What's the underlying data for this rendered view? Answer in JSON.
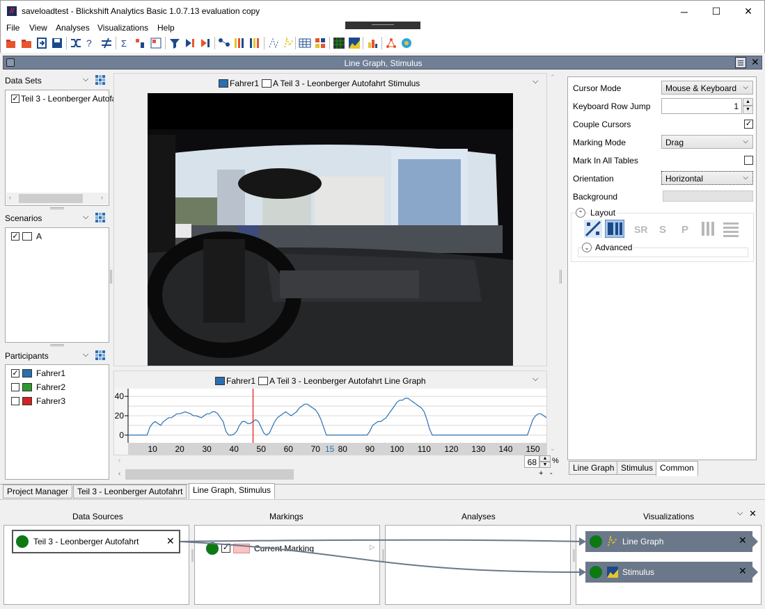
{
  "window": {
    "title": "saveloadtest - Blickshift Analytics Basic 1.0.7.13 evaluation copy",
    "logo_text": "//",
    "minimize": "─",
    "maximize": "☐",
    "close": "✕"
  },
  "menu": [
    "File",
    "View",
    "Analyses",
    "Visualizations",
    "Help"
  ],
  "panel_title": "Line Graph, Stimulus",
  "left": {
    "data_sets_title": "Data Sets",
    "data_set_item": "Teil 3 - Leonberger Autofa",
    "scenarios_title": "Scenarios",
    "scenario_item": "A",
    "participants_title": "Participants",
    "participants": [
      {
        "name": "Fahrer1",
        "checked": "✓",
        "color": "#2a6fb0"
      },
      {
        "name": "Fahrer2",
        "checked": "",
        "color": "#2e9a2e"
      },
      {
        "name": "Fahrer3",
        "checked": "",
        "color": "#d42222"
      }
    ]
  },
  "stimulus": {
    "legend_participant": "Fahrer1",
    "legend_label": "A Teil 3 - Leonberger Autofahrt Stimulus"
  },
  "line_graph": {
    "legend_participant": "Fahrer1",
    "legend_label": "A Teil 3 - Leonberger Autofahrt Line Graph",
    "cursor_value": "15",
    "zoom_value": "68",
    "zoom_unit": "%",
    "zoom_plus": "+",
    "zoom_minus": "-"
  },
  "chart_data": {
    "type": "line",
    "x": [
      1,
      2,
      3,
      4,
      5,
      6,
      7,
      8,
      9,
      10,
      11,
      12,
      13,
      14,
      15,
      16,
      17,
      18,
      19,
      20,
      21,
      22,
      23,
      24,
      25,
      26,
      27,
      28,
      29,
      30,
      31,
      32,
      33,
      34,
      35,
      36,
      37,
      38,
      39,
      40,
      41,
      42,
      43,
      44,
      45,
      46,
      47,
      48,
      49,
      50,
      51,
      52,
      53,
      54,
      55,
      56,
      57,
      58,
      59,
      60,
      61,
      62,
      63,
      64,
      65,
      66,
      67,
      68,
      69,
      70,
      71,
      72,
      73,
      74,
      75,
      76,
      77,
      78,
      79,
      80,
      81,
      82,
      83,
      84,
      85,
      86,
      87,
      88,
      89,
      90,
      91,
      92,
      93,
      94,
      95,
      96,
      97,
      98,
      99,
      100,
      101,
      102,
      103,
      104,
      105,
      106,
      107,
      108,
      109,
      110,
      111,
      112,
      113,
      114,
      115,
      116,
      117,
      118,
      119,
      120,
      121,
      122,
      123,
      124,
      125,
      126,
      127,
      128,
      129,
      130,
      131,
      132,
      133,
      134,
      135,
      136,
      137,
      138,
      139,
      140,
      141,
      142,
      143,
      144,
      145,
      146,
      147,
      148,
      149,
      150,
      151,
      152,
      153,
      154,
      155
    ],
    "y": [
      0,
      0,
      0,
      0,
      0,
      0,
      0,
      0,
      8,
      12,
      14,
      12,
      10,
      14,
      16,
      18,
      18,
      20,
      22,
      22,
      23,
      24,
      23,
      22,
      20,
      20,
      19,
      18,
      20,
      22,
      22,
      24,
      24,
      22,
      18,
      14,
      4,
      0,
      0,
      1,
      4,
      10,
      14,
      14,
      12,
      12,
      14,
      16,
      14,
      8,
      2,
      0,
      2,
      8,
      14,
      18,
      20,
      22,
      24,
      22,
      20,
      22,
      24,
      28,
      30,
      32,
      32,
      30,
      28,
      26,
      22,
      16,
      8,
      0,
      0,
      0,
      0,
      0,
      0,
      0,
      0,
      0,
      0,
      0,
      0,
      0,
      0,
      0,
      0,
      4,
      10,
      12,
      14,
      14,
      16,
      18,
      22,
      26,
      30,
      34,
      36,
      36,
      38,
      38,
      36,
      34,
      32,
      30,
      28,
      24,
      16,
      6,
      0,
      0,
      0,
      0,
      0,
      0,
      0,
      0,
      0,
      0,
      0,
      0,
      0,
      0,
      0,
      0,
      0,
      0,
      0,
      0,
      0,
      0,
      0,
      0,
      0,
      0,
      0,
      0,
      0,
      0,
      0,
      0,
      0,
      0,
      0,
      0,
      8,
      16,
      20,
      22,
      22,
      20,
      18,
      14
    ],
    "series": [
      {
        "name": "Fahrer1",
        "color": "#2a6fb0"
      }
    ],
    "xlim": [
      1,
      155
    ],
    "ylim": [
      -8,
      48
    ],
    "xticks": [
      10,
      20,
      30,
      40,
      50,
      60,
      70,
      80,
      90,
      100,
      110,
      120,
      130,
      140,
      150
    ],
    "yticks": [
      0,
      20,
      40
    ],
    "cursor_x": 47,
    "grid": true
  },
  "properties": {
    "rows": [
      {
        "label": "Cursor Mode",
        "value": "Mouse & Keyboard",
        "kind": "dropdown"
      },
      {
        "label": "Keyboard Row Jump",
        "value": "1",
        "kind": "spinner"
      },
      {
        "label": "Couple Cursors",
        "value": "✓",
        "kind": "checkbox"
      },
      {
        "label": "Marking Mode",
        "value": "Drag",
        "kind": "dropdown"
      },
      {
        "label": "Mark In All Tables",
        "value": "",
        "kind": "checkbox"
      },
      {
        "label": "Orientation",
        "value": "Horizontal",
        "kind": "dropdown"
      },
      {
        "label": "Background",
        "value": "",
        "kind": "color"
      }
    ],
    "layout_label": "Layout",
    "advanced_label": "Advanced",
    "tabs": [
      "Line Graph",
      "Stimulus",
      "Common"
    ]
  },
  "doc_tabs": [
    "Project Manager",
    "Teil 3 - Leonberger Autofahrt",
    "Line Graph, Stimulus"
  ],
  "pipeline": {
    "columns": [
      "Data Sources",
      "Markings",
      "Analyses",
      "Visualizations"
    ],
    "data_source": "Teil 3 - Leonberger Autofahrt",
    "marking": "Current Marking",
    "vis": [
      "Line Graph",
      "Stimulus"
    ]
  },
  "colors": {
    "accent": "#2a6fb0",
    "panel_header": "#6f7f95",
    "vis_node": "#6b7889",
    "cursor": "#e02020"
  }
}
